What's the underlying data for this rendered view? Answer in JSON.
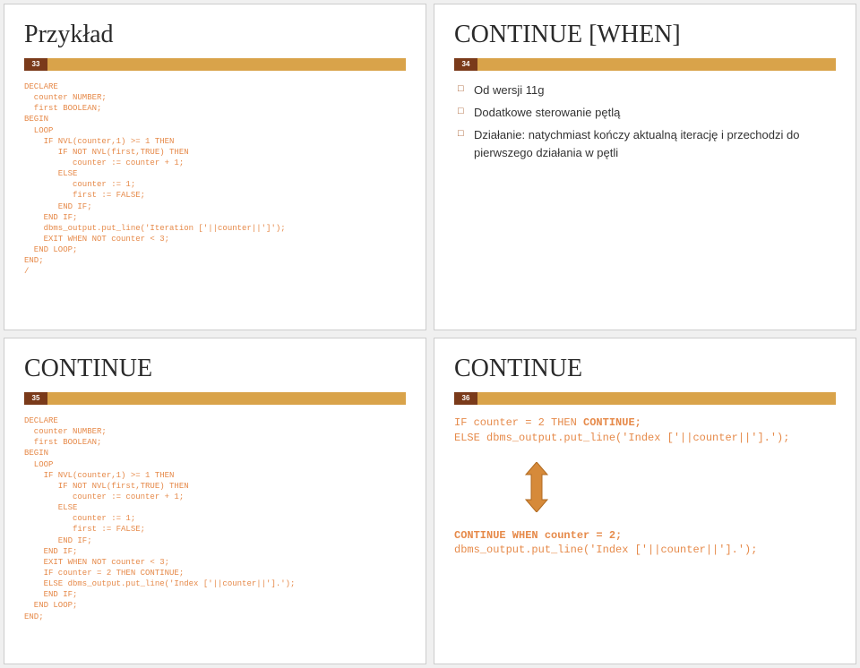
{
  "slide33": {
    "num": "33",
    "title": "Przykład",
    "code": "DECLARE\n  counter NUMBER;\n  first BOOLEAN;\nBEGIN\n  LOOP\n    IF NVL(counter,1) >= 1 THEN\n       IF NOT NVL(first,TRUE) THEN\n          counter := counter + 1;\n       ELSE\n          counter := 1;\n          first := FALSE;\n       END IF;\n    END IF;\n    dbms_output.put_line('Iteration ['||counter||']');\n    EXIT WHEN NOT counter < 3;\n  END LOOP;\nEND;\n/"
  },
  "slide34": {
    "num": "34",
    "title": "CONTINUE [WHEN]",
    "b1": "Od wersji 11g",
    "b2": "Dodatkowe sterowanie pętlą",
    "b3": "Działanie: natychmiast kończy aktualną iterację i przechodzi do pierwszego działania w pętli"
  },
  "slide35": {
    "num": "35",
    "title": "CONTINUE",
    "code": "DECLARE\n  counter NUMBER;\n  first BOOLEAN;\nBEGIN\n  LOOP\n    IF NVL(counter,1) >= 1 THEN\n       IF NOT NVL(first,TRUE) THEN\n          counter := counter + 1;\n       ELSE\n          counter := 1;\n          first := FALSE;\n       END IF;\n    END IF;\n    EXIT WHEN NOT counter < 3;\n    IF counter = 2 THEN CONTINUE;\n    ELSE dbms_output.put_line('Index ['||counter||'].');\n    END IF;\n  END LOOP;\nEND;"
  },
  "slide36": {
    "num": "36",
    "title": "CONTINUE",
    "line1a": "IF counter = 2 THEN ",
    "line1b": "CONTINUE;",
    "line2": "ELSE dbms_output.put_line('Index ['||counter||'].');",
    "line3a": "CONTINUE WHEN counter = 2;",
    "line4": "dbms_output.put_line('Index ['||counter||'].');"
  }
}
